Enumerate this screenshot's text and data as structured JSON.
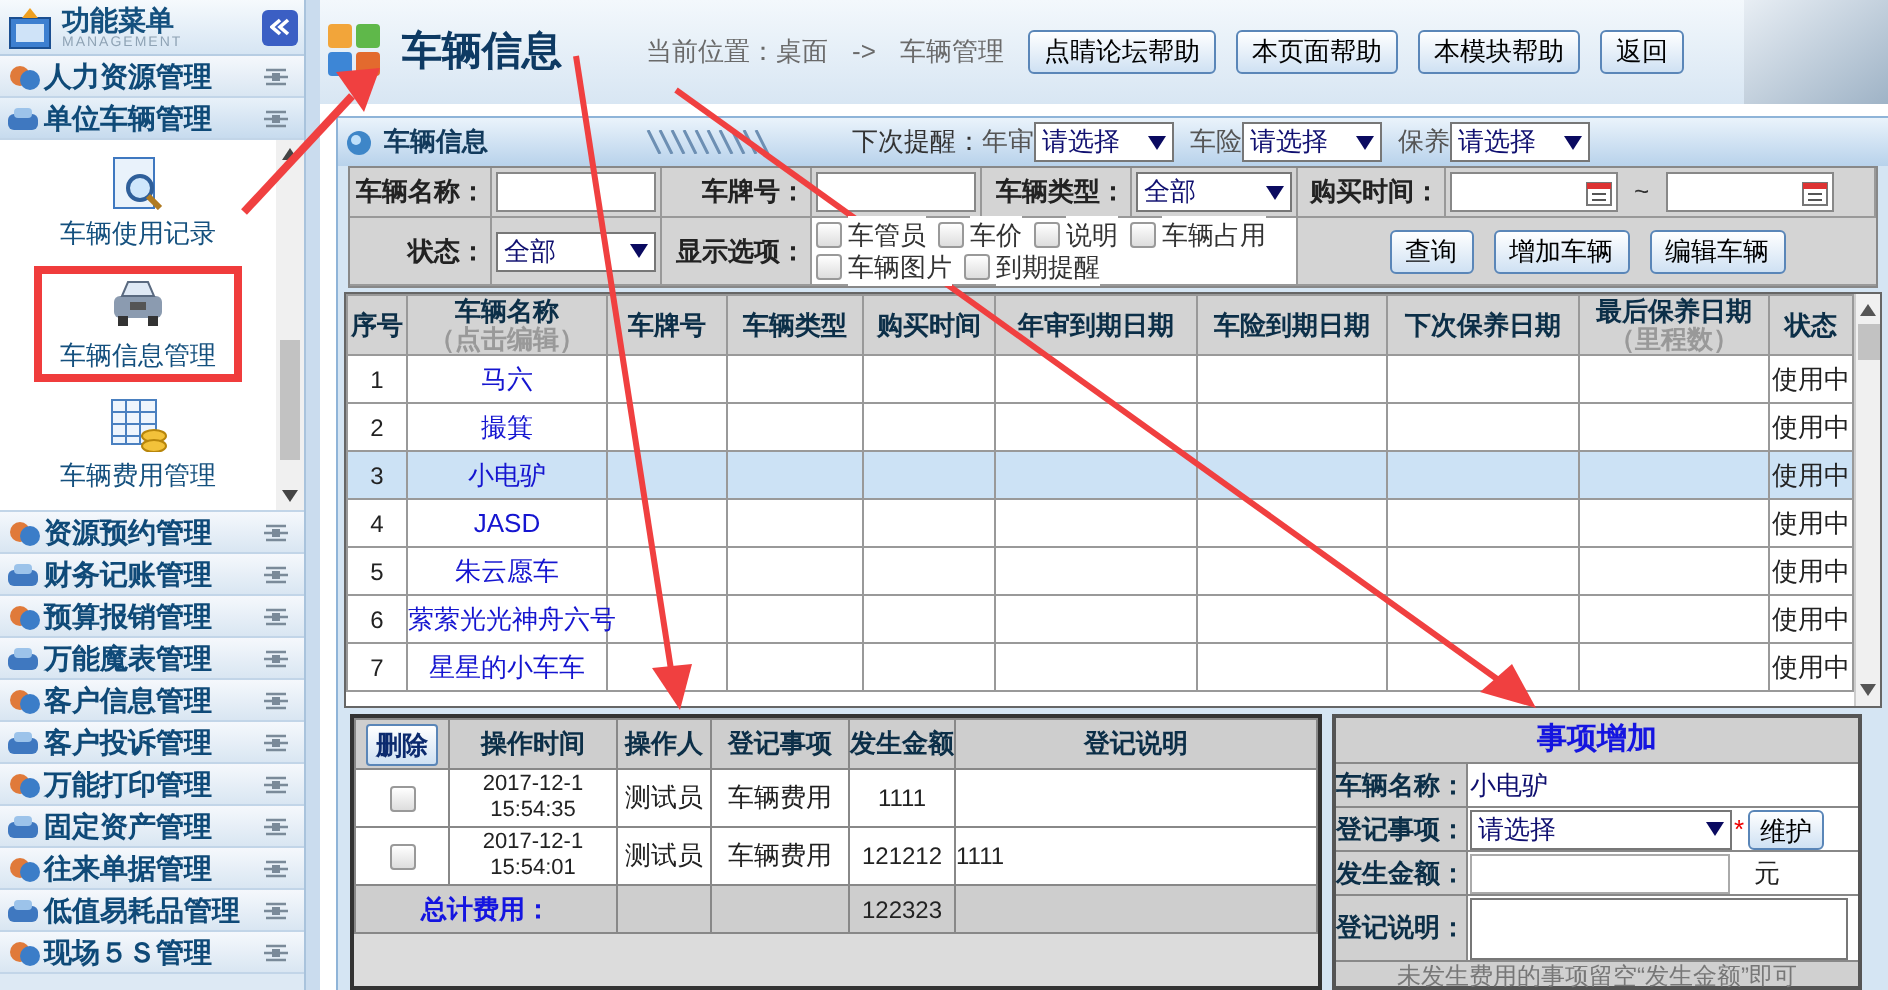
{
  "sidebar": {
    "title": "功能菜单",
    "subtitle": "MANAGEMENT",
    "sections": [
      {
        "label": "人力资源管理",
        "expanded": false
      },
      {
        "label": "单位车辆管理",
        "expanded": true,
        "items": [
          {
            "label": "车辆使用记录",
            "selected": false
          },
          {
            "label": "车辆信息管理",
            "selected": true
          },
          {
            "label": "车辆费用管理",
            "selected": false
          }
        ]
      },
      {
        "label": "资源预约管理",
        "expanded": false
      },
      {
        "label": "财务记账管理",
        "expanded": false
      },
      {
        "label": "预算报销管理",
        "expanded": false
      },
      {
        "label": "万能魔表管理",
        "expanded": false
      },
      {
        "label": "客户信息管理",
        "expanded": false
      },
      {
        "label": "客户投诉管理",
        "expanded": false
      },
      {
        "label": "万能打印管理",
        "expanded": false
      },
      {
        "label": "固定资产管理",
        "expanded": false
      },
      {
        "label": "往来单据管理",
        "expanded": false
      },
      {
        "label": "低值易耗品管理",
        "expanded": false
      },
      {
        "label": "现场５Ｓ管理",
        "expanded": false
      }
    ]
  },
  "header": {
    "title": "车辆信息",
    "breadcrumb": [
      "当前位置：桌面",
      "->",
      "车辆管理"
    ],
    "buttons": [
      "点睛论坛帮助",
      "本页面帮助",
      "本模块帮助",
      "返回"
    ]
  },
  "panel": {
    "title": "车辆信息",
    "reminder_label": "下次提醒：",
    "reminders": [
      {
        "label": "年审",
        "value": "请选择"
      },
      {
        "label": "车险",
        "value": "请选择"
      },
      {
        "label": "保养",
        "value": "请选择"
      }
    ]
  },
  "filters": {
    "name_label": "车辆名称：",
    "plate_label": "车牌号：",
    "type_label": "车辆类型：",
    "type_value": "全部",
    "purchase_label": "购买时间：",
    "range_separator": "~",
    "status_label": "状态：",
    "status_value": "全部",
    "options_label": "显示选项：",
    "options": [
      {
        "label": "车管员",
        "checked": false
      },
      {
        "label": "车价",
        "checked": false
      },
      {
        "label": "说明",
        "checked": false
      },
      {
        "label": "车辆占用",
        "checked": false
      },
      {
        "label": "车辆图片",
        "checked": false
      },
      {
        "label": "到期提醒",
        "checked": false
      }
    ],
    "buttons": [
      "查询",
      "增加车辆",
      "编辑车辆"
    ]
  },
  "vehicles": {
    "columns": [
      {
        "label": "序号"
      },
      {
        "label": "车辆名称",
        "sub": "（点击编辑）"
      },
      {
        "label": "车牌号"
      },
      {
        "label": "车辆类型"
      },
      {
        "label": "购买时间"
      },
      {
        "label": "年审到期日期"
      },
      {
        "label": "车险到期日期"
      },
      {
        "label": "下次保养日期"
      },
      {
        "label": "最后保养日期",
        "sub": "（里程数）"
      },
      {
        "label": "状态"
      }
    ],
    "rows": [
      {
        "no": "1",
        "name": "马六",
        "status": "使用中",
        "selected": false
      },
      {
        "no": "2",
        "name": "撮箕",
        "status": "使用中",
        "selected": false
      },
      {
        "no": "3",
        "name": "小电驴",
        "status": "使用中",
        "selected": true
      },
      {
        "no": "4",
        "name": "JASD",
        "status": "使用中",
        "selected": false
      },
      {
        "no": "5",
        "name": "朱云愿车",
        "status": "使用中",
        "selected": false
      },
      {
        "no": "6",
        "name": "萦萦光光神舟六号",
        "status": "使用中",
        "selected": false
      },
      {
        "no": "7",
        "name": "星星的小车车",
        "status": "使用中",
        "selected": false
      }
    ]
  },
  "expenses": {
    "delete_button": "删除",
    "columns": [
      "操作时间",
      "操作人",
      "登记事项",
      "发生金额",
      "登记说明"
    ],
    "rows": [
      {
        "checked": false,
        "date": "2017-12-1",
        "time": "15:54:35",
        "operator": "测试员",
        "item": "车辆费用",
        "amount": "1111"
      },
      {
        "checked": false,
        "date": "2017-12-1",
        "time": "15:54:01",
        "operator": "测试员",
        "item": "车辆费用",
        "amount": "121212",
        "note": "1111"
      }
    ],
    "total": {
      "label": "总计费用：",
      "amount": "122323"
    }
  },
  "add_form": {
    "title": "事项增加",
    "fields": [
      {
        "kind": "text",
        "label": "车辆名称：",
        "value": "小电驴"
      },
      {
        "kind": "select",
        "label": "登记事项：",
        "value": "请选择",
        "required_mark": "*",
        "button": "维护"
      },
      {
        "kind": "amount",
        "label": "发生金额：",
        "unit": "元"
      },
      {
        "kind": "textarea",
        "label": "登记说明："
      }
    ],
    "note": "未发生费用的事项留空“发生金额”即可"
  }
}
